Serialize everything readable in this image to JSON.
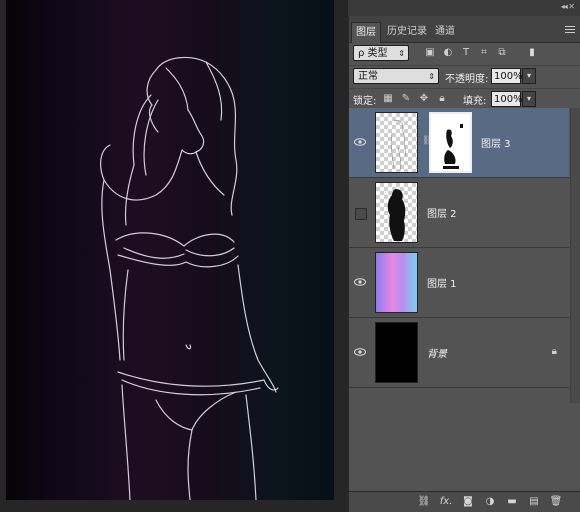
{
  "panel": {
    "tabs": [
      {
        "label": "图层",
        "active": true
      },
      {
        "label": "历史记录",
        "active": false
      },
      {
        "label": "通道",
        "active": false
      }
    ],
    "filter": {
      "label": "ρ 类型",
      "icons": [
        "image-filter-icon",
        "adjustment-filter-icon",
        "text-filter-icon",
        "shape-filter-icon",
        "smart-object-filter-icon",
        "filter-toggle-icon"
      ]
    },
    "blend": {
      "mode": "正常",
      "opacity_label": "不透明度:",
      "opacity_value": "100%"
    },
    "lock": {
      "label": "锁定:",
      "fill_label": "填充:",
      "fill_value": "100%"
    },
    "layers": [
      {
        "name": "图层 3",
        "visible": true,
        "selected": true,
        "has_mask": true
      },
      {
        "name": "图层 2",
        "visible": false,
        "selected": false,
        "has_mask": false
      },
      {
        "name": "图层 1",
        "visible": true,
        "selected": false,
        "has_mask": false
      },
      {
        "name": "背景",
        "visible": true,
        "selected": false,
        "locked": true
      }
    ],
    "bottom_icons": [
      "link-icon",
      "fx-icon",
      "add-mask-icon",
      "adjustment-layer-icon",
      "group-folder-icon",
      "new-layer-icon",
      "trash-icon"
    ],
    "bottom_fx": "fx."
  },
  "colors": {
    "selected_layer": "#596b84",
    "panel_bg": "#535353"
  }
}
